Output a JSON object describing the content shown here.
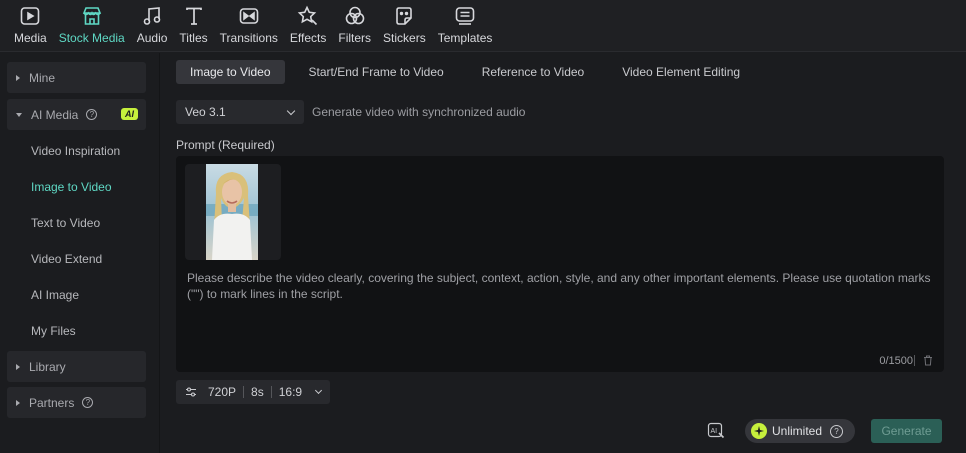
{
  "toolbar": {
    "items": [
      {
        "label": "Media",
        "icon": "media-icon"
      },
      {
        "label": "Stock Media",
        "icon": "stock-media-icon"
      },
      {
        "label": "Audio",
        "icon": "audio-icon"
      },
      {
        "label": "Titles",
        "icon": "titles-icon"
      },
      {
        "label": "Transitions",
        "icon": "transitions-icon"
      },
      {
        "label": "Effects",
        "icon": "effects-icon"
      },
      {
        "label": "Filters",
        "icon": "filters-icon"
      },
      {
        "label": "Stickers",
        "icon": "stickers-icon"
      },
      {
        "label": "Templates",
        "icon": "templates-icon"
      }
    ],
    "active": "Stock Media"
  },
  "sidebar": {
    "mine": "Mine",
    "ai_media": {
      "label": "AI Media",
      "badge": "AI"
    },
    "items": [
      "Video Inspiration",
      "Image to Video",
      "Text to Video",
      "Video Extend",
      "AI Image",
      "My Files"
    ],
    "active_item": "Image to Video",
    "library": "Library",
    "partners": "Partners"
  },
  "main": {
    "tabs": [
      "Image to Video",
      "Start/End Frame to Video",
      "Reference to Video",
      "Video Element Editing"
    ],
    "active_tab": "Image to Video",
    "model": {
      "value": "Veo 3.1",
      "description": "Generate video with synchronized audio"
    },
    "prompt": {
      "label": "Prompt (Required)",
      "placeholder": "Please describe the video clearly, covering the subject, context, action, style, and any other important elements. Please use quotation marks (\"\") to mark lines in the script.",
      "counter": "0/1500"
    },
    "settings": {
      "resolution": "720P",
      "duration": "8s",
      "aspect": "16:9"
    },
    "unlimited_label": "Unlimited",
    "generate_label": "Generate"
  },
  "colors": {
    "accent": "#5fd8c4",
    "ai_badge": "#c6f03c",
    "generate_bg": "#2b5f56"
  }
}
